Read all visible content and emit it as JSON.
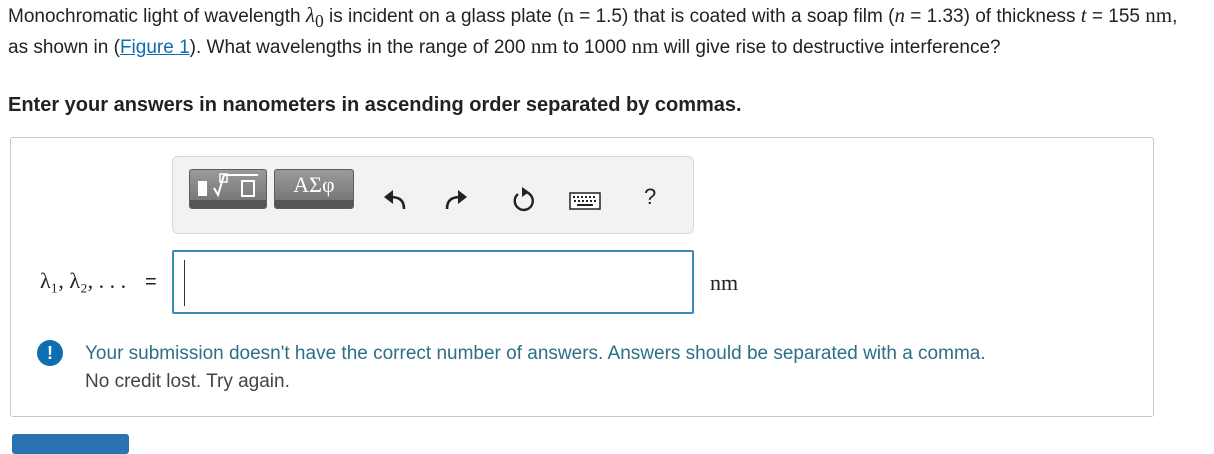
{
  "question": {
    "p1": "Monochromatic light of wavelength ",
    "lambda0": "λ",
    "lambda0_sub": "0",
    "p2": " is incident on a glass plate (",
    "n_glass": "n",
    "p3": " = 1.5) that is coated with a soap film (",
    "n_film": "n",
    "p4": " = 1.33) of thickness ",
    "t_sym": "t",
    "p5": " = 155 ",
    "unit1": "nm",
    "p6": ", as shown in (",
    "figure_link": "Figure 1",
    "p7": "). What wavelengths in the range of 200 ",
    "unit2": "nm",
    "p8": " to 1000 ",
    "unit3": "nm",
    "p9": " will give rise to destructive interference?"
  },
  "instruction": "Enter your answers in nanometers in ascending order separated by commas.",
  "toolbar": {
    "greek_label": "ΑΣφ",
    "help_label": "?",
    "icons": [
      "templates-icon",
      "undo-icon",
      "redo-icon",
      "reset-icon",
      "keyboard-icon",
      "help-icon"
    ]
  },
  "answer": {
    "lhs": "λ₁, λ₂, . . .",
    "equals": "=",
    "value": "",
    "unit": "nm"
  },
  "feedback": {
    "icon": "!",
    "message": "Your submission doesn't have the correct number of answers. Answers should be separated with a comma.",
    "sub": "No credit lost. Try again."
  },
  "colors": {
    "link": "#0c6dad",
    "feedback_text": "#2d6f86",
    "alert_icon": "#0e6fb0",
    "input_border": "#3c88b8"
  }
}
